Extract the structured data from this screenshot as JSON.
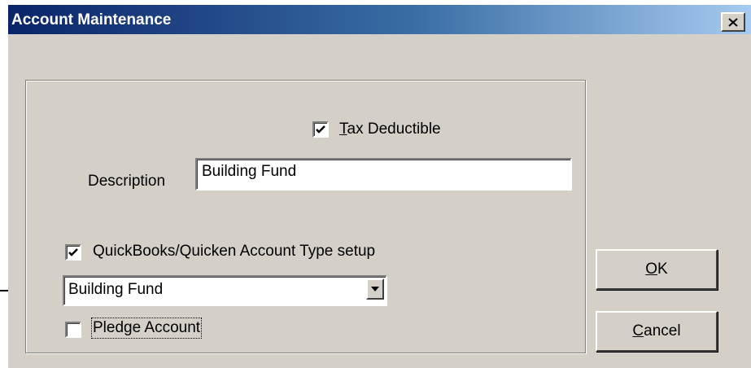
{
  "window": {
    "title": "Account Maintenance",
    "close_icon": "close-icon",
    "titlebar_color": "#0a246a"
  },
  "form": {
    "tax_deductible": {
      "label_mnemonic": "T",
      "label_rest": "ax Deductible",
      "checked": true
    },
    "description": {
      "label": "Description",
      "value": "Building Fund"
    },
    "quickbooks_setup": {
      "label": "QuickBooks/Quicken Account Type setup",
      "checked": true
    },
    "account_type": {
      "selected": "Building Fund",
      "arrow_icon": "dropdown-arrow-icon"
    },
    "pledge_account": {
      "label": "Pledge Account",
      "checked": false
    }
  },
  "buttons": {
    "ok": {
      "mnemonic": "O",
      "rest": "K"
    },
    "cancel": {
      "mnemonic": "C",
      "rest": "ancel"
    }
  },
  "annotation": {
    "icon": "pointer-arrow-icon"
  }
}
